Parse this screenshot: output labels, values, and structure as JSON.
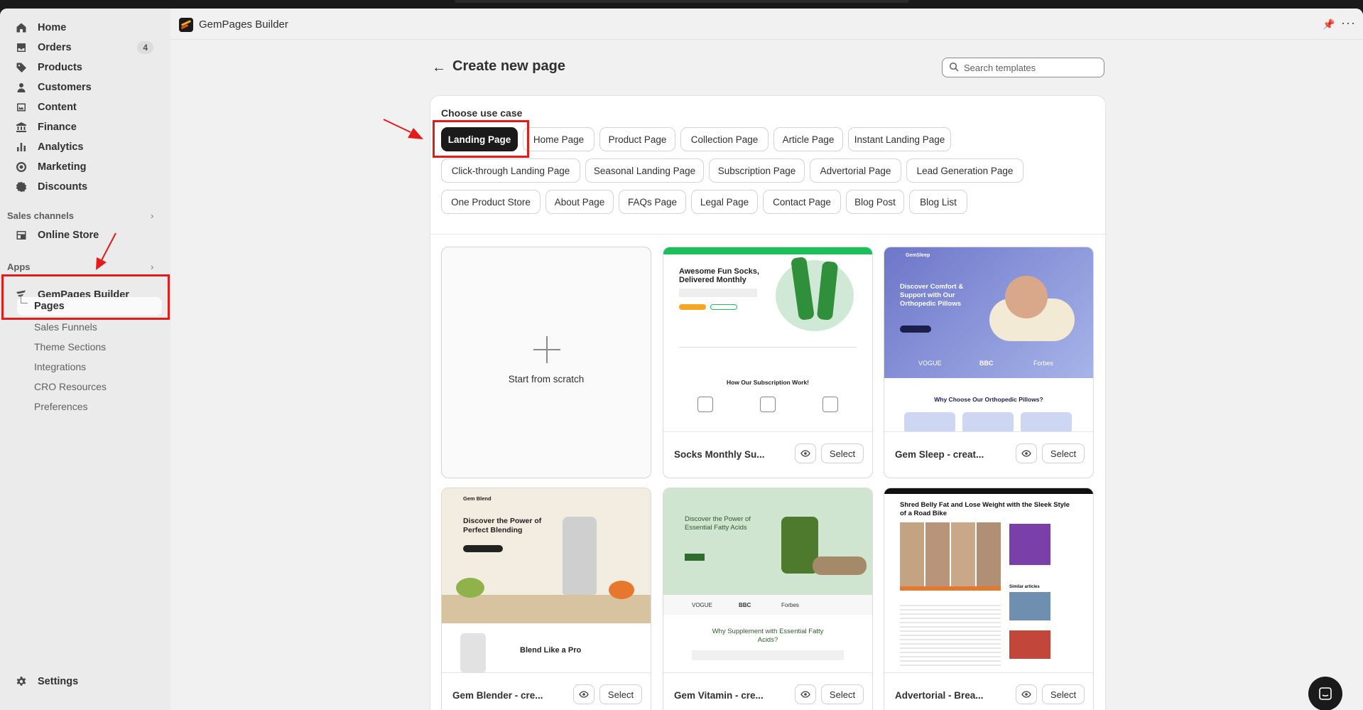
{
  "window": {
    "app_title": "GemPages Builder"
  },
  "sidebar": {
    "items": [
      {
        "label": "Home",
        "icon": "home-icon"
      },
      {
        "label": "Orders",
        "icon": "orders-icon",
        "badge": "4"
      },
      {
        "label": "Products",
        "icon": "tag-icon"
      },
      {
        "label": "Customers",
        "icon": "person-icon"
      },
      {
        "label": "Content",
        "icon": "content-icon"
      },
      {
        "label": "Finance",
        "icon": "bank-icon"
      },
      {
        "label": "Analytics",
        "icon": "bar-chart-icon"
      },
      {
        "label": "Marketing",
        "icon": "target-icon"
      },
      {
        "label": "Discounts",
        "icon": "discount-icon"
      }
    ],
    "sales_channels_label": "Sales channels",
    "online_store_label": "Online Store",
    "apps_label": "Apps",
    "gempages_label": "GemPages Builder",
    "sub_items": [
      "Pages",
      "Sales Funnels",
      "Theme Sections",
      "Integrations",
      "CRO Resources",
      "Preferences"
    ],
    "settings_label": "Settings"
  },
  "main": {
    "title": "Create new page",
    "search_placeholder": "Search templates",
    "choose_label": "Choose use case",
    "use_cases": [
      "Landing Page",
      "Home Page",
      "Product Page",
      "Collection Page",
      "Article Page",
      "Instant Landing Page",
      "Click-through Landing Page",
      "Seasonal Landing Page",
      "Subscription Page",
      "Advertorial Page",
      "Lead Generation Page",
      "One Product Store",
      "About Page",
      "FAQs Page",
      "Legal Page",
      "Contact Page",
      "Blog Post",
      "Blog List"
    ],
    "active_use_case": "Landing Page",
    "scratch_label": "Start from scratch",
    "select_label": "Select",
    "templates": [
      {
        "name": "Socks Monthly Su...",
        "headline": "Awesome Fun Socks, Delivered Monthly",
        "section": "How Our Subscription Work!"
      },
      {
        "name": "Gem Sleep - creat...",
        "headline": "Discover Comfort & Support with Our Orthopedic Pillows",
        "section": "Why Choose Our Orthopedic Pillows?",
        "brand": "GemSleep"
      },
      {
        "name": "Gem Blender - cre...",
        "headline": "Discover the Power of Perfect Blending",
        "section": "Blend Like a Pro",
        "brand": "Gem Blend"
      },
      {
        "name": "Gem Vitamin - cre...",
        "headline": "Discover the Power of Essential Fatty Acids",
        "section": "Why Supplement with Essential Fatty Acids?"
      },
      {
        "name": "Advertorial - Brea...",
        "headline": "Shred Belly Fat and Lose Weight with the Sleek Style of a Road Bike",
        "section": "Similar articles"
      }
    ],
    "press_logos": [
      "VOGUE",
      "BBC",
      "Forbes"
    ]
  },
  "colors": {
    "accent_red": "#e21b1b",
    "chip_active": "#1a1a1a",
    "sidebar_bg": "#ebebeb"
  }
}
